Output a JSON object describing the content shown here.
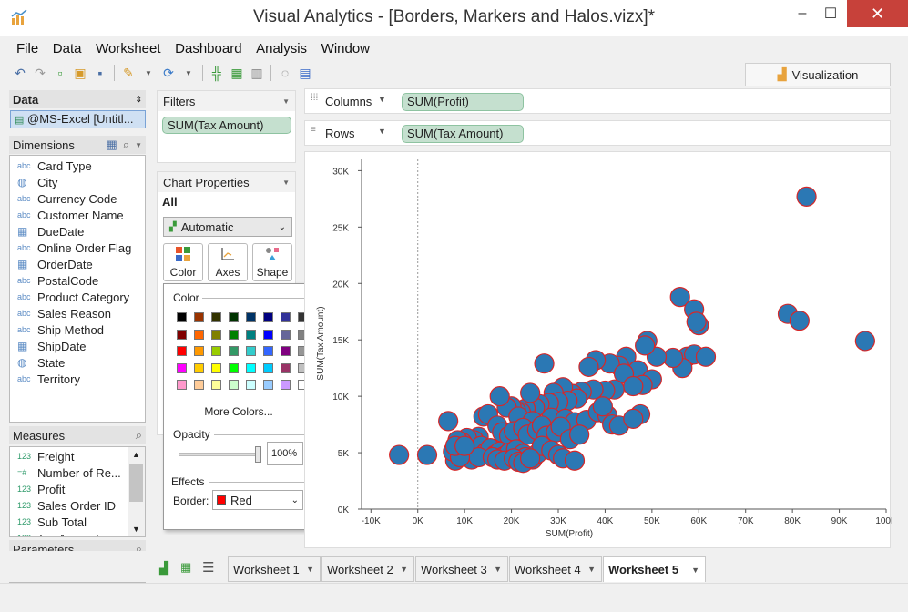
{
  "window": {
    "title": "Visual Analytics - [Borders, Markers and Halos.vizx]*",
    "minimize": "‒",
    "maximize": "☐",
    "close": "✕"
  },
  "menu": [
    "File",
    "Data",
    "Worksheet",
    "Dashboard",
    "Analysis",
    "Window"
  ],
  "toolbar": {
    "visualization_tab": "Visualization"
  },
  "data_pane": {
    "header": "Data",
    "datasource": "@MS-Excel [Untitl...",
    "dimensions_header": "Dimensions",
    "dimensions": [
      {
        "type": "abc",
        "name": "Card Type"
      },
      {
        "type": "geo",
        "name": "City"
      },
      {
        "type": "abc",
        "name": "Currency Code"
      },
      {
        "type": "abc",
        "name": "Customer Name"
      },
      {
        "type": "date",
        "name": "DueDate"
      },
      {
        "type": "abc",
        "name": "Online Order Flag"
      },
      {
        "type": "date",
        "name": "OrderDate"
      },
      {
        "type": "abc",
        "name": "PostalCode"
      },
      {
        "type": "abc",
        "name": "Product Category"
      },
      {
        "type": "abc",
        "name": "Sales Reason"
      },
      {
        "type": "abc",
        "name": "Ship Method"
      },
      {
        "type": "date",
        "name": "ShipDate"
      },
      {
        "type": "geo",
        "name": "State"
      },
      {
        "type": "abc",
        "name": "Territory"
      }
    ],
    "measures_header": "Measures",
    "measures": [
      {
        "type": "123",
        "name": "Freight"
      },
      {
        "type": "calc",
        "name": "Number of Re..."
      },
      {
        "type": "123",
        "name": "Profit"
      },
      {
        "type": "123",
        "name": "Sales Order ID"
      },
      {
        "type": "123",
        "name": "Sub Total"
      },
      {
        "type": "123",
        "name": "Tax Amount"
      }
    ],
    "parameters_header": "Parameters"
  },
  "filters": {
    "header": "Filters",
    "pill": "SUM(Tax Amount)"
  },
  "chart_properties": {
    "header": "Chart Properties",
    "all_label": "All",
    "mark_type": "Automatic",
    "buttons": {
      "color": "Color",
      "axes": "Axes",
      "shape": "Shape"
    }
  },
  "color_popup": {
    "color_label": "Color",
    "swatches": [
      [
        "#000000",
        "#993300",
        "#333300",
        "#003300",
        "#003366",
        "#000080",
        "#333399",
        "#333333"
      ],
      [
        "#800000",
        "#ff6600",
        "#808000",
        "#008000",
        "#008080",
        "#0000ff",
        "#666699",
        "#808080"
      ],
      [
        "#ff0000",
        "#ff9900",
        "#99cc00",
        "#339966",
        "#33cccc",
        "#3366ff",
        "#800080",
        "#969696"
      ],
      [
        "#ff00ff",
        "#ffcc00",
        "#ffff00",
        "#00ff00",
        "#00ffff",
        "#00ccff",
        "#993366",
        "#c0c0c0"
      ],
      [
        "#ff99cc",
        "#ffcc99",
        "#ffff99",
        "#ccffcc",
        "#ccffff",
        "#99ccff",
        "#cc99ff",
        "#ffffff"
      ]
    ],
    "more_colors": "More Colors...",
    "opacity_label": "Opacity",
    "opacity_value": "100%",
    "opacity": 1.0,
    "effects_label": "Effects",
    "border_label": "Border:",
    "border_value": "Red",
    "border_color": "#ff0000"
  },
  "shelves": {
    "columns_label": "Columns",
    "columns_pill": "SUM(Profit)",
    "rows_label": "Rows",
    "rows_pill": "SUM(Tax Amount)"
  },
  "chart_data": {
    "type": "scatter",
    "xlabel": "SUM(Profit)",
    "ylabel": "SUM(Tax Amount)",
    "xlim": [
      -12000,
      100000
    ],
    "ylim": [
      0,
      31000
    ],
    "xticks": [
      -10000,
      0,
      10000,
      20000,
      30000,
      40000,
      50000,
      60000,
      70000,
      80000,
      90000,
      100000
    ],
    "xtick_labels": [
      "-10K",
      "0K",
      "10K",
      "20K",
      "30K",
      "40K",
      "50K",
      "60K",
      "70K",
      "80K",
      "90K",
      "100K"
    ],
    "yticks": [
      0,
      5000,
      10000,
      15000,
      20000,
      25000,
      30000
    ],
    "ytick_labels": [
      "0K",
      "5K",
      "10K",
      "15K",
      "20K",
      "25K",
      "30K"
    ],
    "marker_fill": "#2b78b4",
    "marker_border": "#d62728",
    "grid": false,
    "zero_line": true,
    "points": [
      [
        83000,
        27700
      ],
      [
        79000,
        17300
      ],
      [
        81500,
        16700
      ],
      [
        95500,
        14900
      ],
      [
        56000,
        18800
      ],
      [
        59000,
        17700
      ],
      [
        60000,
        16300
      ],
      [
        59500,
        16600
      ],
      [
        57500,
        13500
      ],
      [
        59000,
        13700
      ],
      [
        61500,
        13500
      ],
      [
        56500,
        12500
      ],
      [
        54500,
        13400
      ],
      [
        51000,
        13500
      ],
      [
        49000,
        14900
      ],
      [
        48500,
        14500
      ],
      [
        44500,
        13500
      ],
      [
        43000,
        12700
      ],
      [
        41000,
        12900
      ],
      [
        38000,
        13200
      ],
      [
        36500,
        12600
      ],
      [
        27000,
        12900
      ],
      [
        47000,
        12300
      ],
      [
        44000,
        12000
      ],
      [
        50000,
        11500
      ],
      [
        48000,
        11000
      ],
      [
        46000,
        10900
      ],
      [
        42000,
        10600
      ],
      [
        40000,
        10500
      ],
      [
        37500,
        10600
      ],
      [
        35000,
        10400
      ],
      [
        33000,
        10200
      ],
      [
        31000,
        10800
      ],
      [
        29000,
        10300
      ],
      [
        34000,
        9800
      ],
      [
        32000,
        9600
      ],
      [
        30000,
        9500
      ],
      [
        28000,
        9400
      ],
      [
        26000,
        9300
      ],
      [
        25000,
        9000
      ],
      [
        23000,
        8900
      ],
      [
        22000,
        8600
      ],
      [
        21000,
        8700
      ],
      [
        20000,
        9100
      ],
      [
        19000,
        9000
      ],
      [
        17500,
        10000
      ],
      [
        24000,
        10300
      ],
      [
        21500,
        8200
      ],
      [
        24500,
        7800
      ],
      [
        28500,
        8100
      ],
      [
        31500,
        8000
      ],
      [
        33500,
        7700
      ],
      [
        36000,
        7900
      ],
      [
        38500,
        8600
      ],
      [
        40500,
        8300
      ],
      [
        41500,
        7500
      ],
      [
        43000,
        7400
      ],
      [
        47500,
        8400
      ],
      [
        46000,
        8000
      ],
      [
        39500,
        9100
      ],
      [
        14000,
        8200
      ],
      [
        15000,
        8400
      ],
      [
        17000,
        7400
      ],
      [
        18000,
        6800
      ],
      [
        19500,
        6500
      ],
      [
        20500,
        6900
      ],
      [
        22500,
        7200
      ],
      [
        23500,
        6600
      ],
      [
        25500,
        7000
      ],
      [
        26500,
        7400
      ],
      [
        27500,
        6500
      ],
      [
        29500,
        6800
      ],
      [
        30500,
        7300
      ],
      [
        32500,
        6200
      ],
      [
        34500,
        6600
      ],
      [
        13000,
        6400
      ],
      [
        12000,
        6100
      ],
      [
        10500,
        6300
      ],
      [
        9500,
        5900
      ],
      [
        8500,
        6100
      ],
      [
        11000,
        5200
      ],
      [
        13500,
        5600
      ],
      [
        14500,
        5000
      ],
      [
        15500,
        5400
      ],
      [
        16500,
        4800
      ],
      [
        17500,
        5100
      ],
      [
        18500,
        4700
      ],
      [
        19500,
        5000
      ],
      [
        21000,
        5300
      ],
      [
        22500,
        4900
      ],
      [
        23000,
        4600
      ],
      [
        24500,
        4400
      ],
      [
        25500,
        4900
      ],
      [
        26500,
        5600
      ],
      [
        28500,
        5200
      ],
      [
        30000,
        4800
      ],
      [
        31000,
        4500
      ],
      [
        8000,
        4300
      ],
      [
        11500,
        4400
      ],
      [
        13000,
        4600
      ],
      [
        16000,
        4600
      ],
      [
        17000,
        4400
      ],
      [
        18500,
        4300
      ],
      [
        20500,
        4500
      ],
      [
        21500,
        4200
      ],
      [
        22500,
        4100
      ],
      [
        24000,
        4500
      ],
      [
        6500,
        7800
      ],
      [
        7500,
        5100
      ],
      [
        9000,
        4600
      ],
      [
        33500,
        4300
      ],
      [
        -4000,
        4800
      ],
      [
        2000,
        4800
      ],
      [
        8000,
        5600
      ],
      [
        10000,
        5600
      ]
    ]
  },
  "tabs": [
    "Worksheet 1",
    "Worksheet 2",
    "Worksheet 3",
    "Worksheet 4",
    "Worksheet 5"
  ],
  "active_tab": "Worksheet 5"
}
